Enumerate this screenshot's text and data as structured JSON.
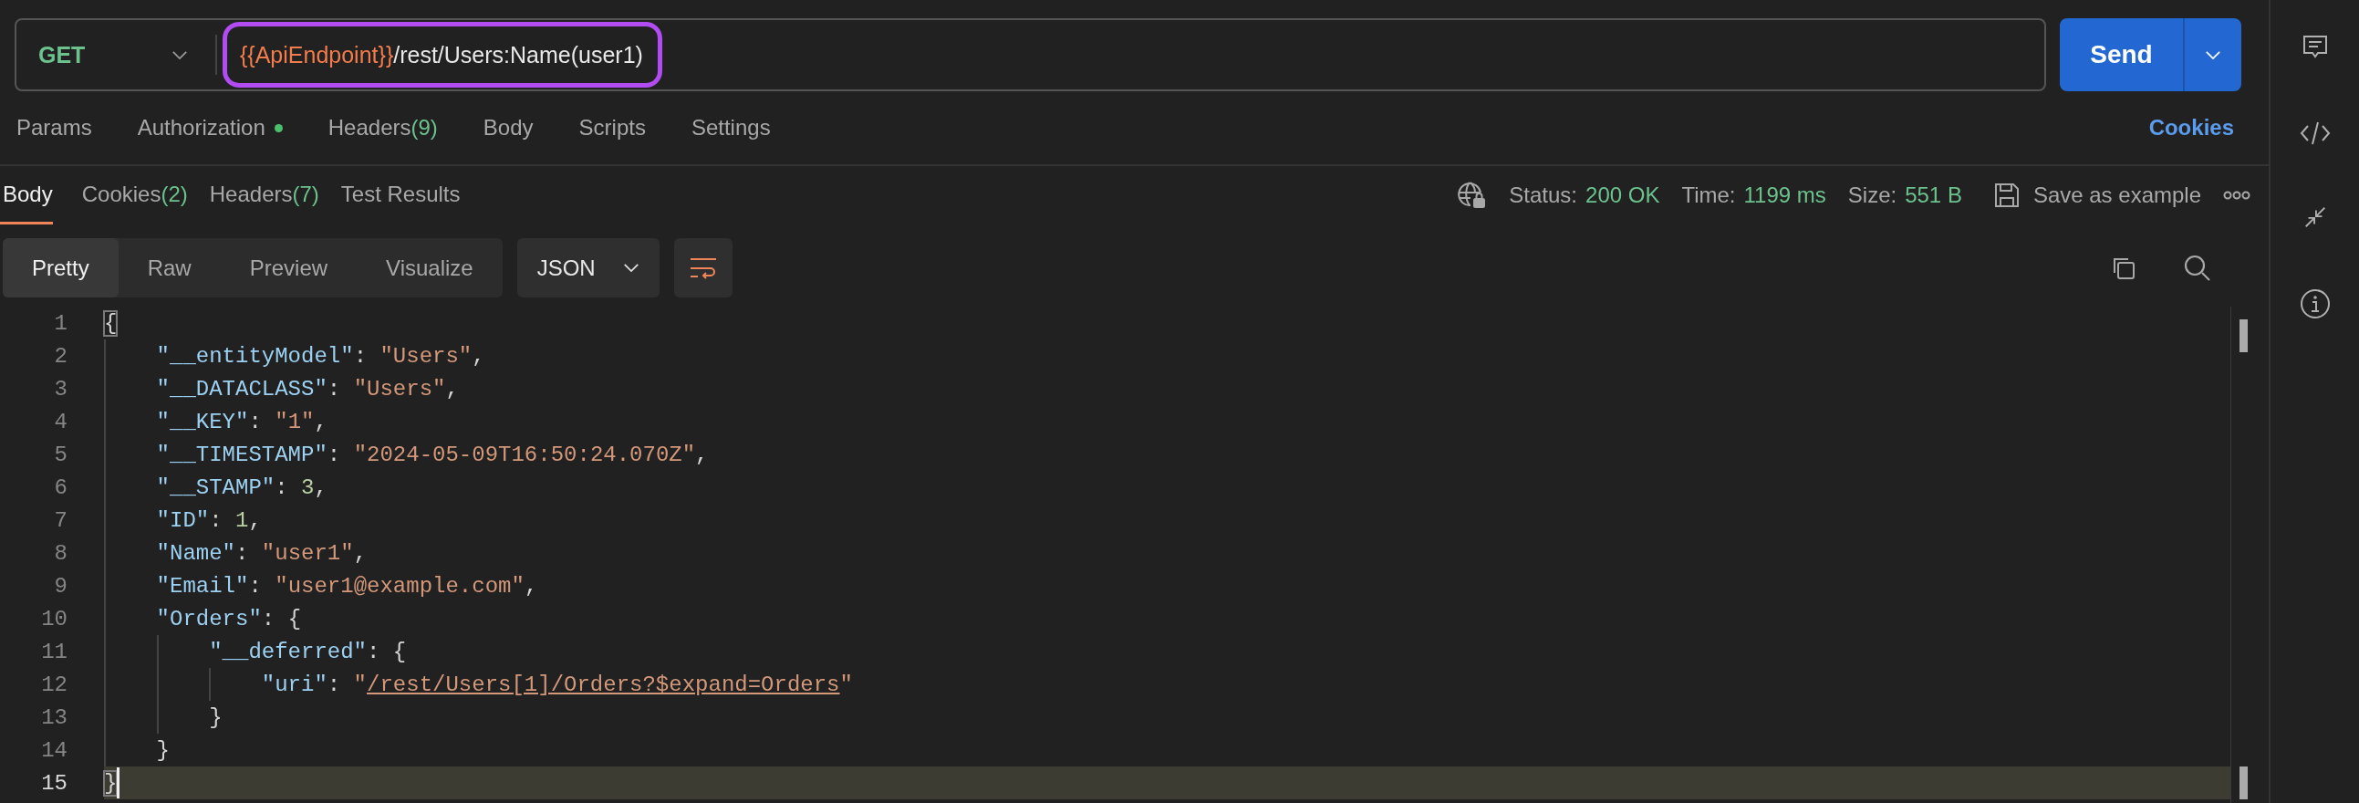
{
  "request": {
    "method": "GET",
    "url_variable": "{{ApiEndpoint}}",
    "url_path": "/rest/Users:Name(user1)",
    "send_label": "Send"
  },
  "request_tabs": [
    {
      "label": "Params",
      "selected": false,
      "dot": false
    },
    {
      "label": "Authorization",
      "selected": false,
      "dot": true
    },
    {
      "label": "Headers",
      "count": "(9)",
      "selected": false,
      "dot": false
    },
    {
      "label": "Body",
      "selected": false,
      "dot": false
    },
    {
      "label": "Scripts",
      "selected": false,
      "dot": false
    },
    {
      "label": "Settings",
      "selected": false,
      "dot": false
    }
  ],
  "cookies_link": "Cookies",
  "response_tabs": [
    {
      "label": "Body",
      "selected": true
    },
    {
      "label": "Cookies",
      "count": "(2)",
      "selected": false
    },
    {
      "label": "Headers",
      "count": "(7)",
      "selected": false
    },
    {
      "label": "Test Results",
      "selected": false
    }
  ],
  "response_meta": [
    {
      "label": "Status:",
      "value": "200 OK"
    },
    {
      "label": "Time:",
      "value": "1199 ms"
    },
    {
      "label": "Size:",
      "value": "551 B"
    }
  ],
  "save_example": "Save as example",
  "view_modes": [
    {
      "label": "Pretty",
      "selected": true
    },
    {
      "label": "Raw",
      "selected": false
    },
    {
      "label": "Preview",
      "selected": false
    },
    {
      "label": "Visualize",
      "selected": false
    }
  ],
  "format": "JSON",
  "response": {
    "lines": [
      {
        "number": "1",
        "current": false,
        "tokens": [
          {
            "kind": "bracket",
            "text": "{",
            "matched": true
          }
        ],
        "children": [
          {
            "number": "2",
            "current": false,
            "tokens": [
              {
                "kind": "key",
                "text": "\"__entityModel\""
              },
              {
                "kind": "punct",
                "text": ": "
              },
              {
                "kind": "string",
                "text": "\"Users\""
              },
              {
                "kind": "punct",
                "text": ","
              }
            ]
          },
          {
            "number": "3",
            "current": false,
            "tokens": [
              {
                "kind": "key",
                "text": "\"__DATACLASS\""
              },
              {
                "kind": "punct",
                "text": ": "
              },
              {
                "kind": "string",
                "text": "\"Users\""
              },
              {
                "kind": "punct",
                "text": ","
              }
            ]
          },
          {
            "number": "4",
            "current": false,
            "tokens": [
              {
                "kind": "key",
                "text": "\"__KEY\""
              },
              {
                "kind": "punct",
                "text": ": "
              },
              {
                "kind": "string",
                "text": "\"1\""
              },
              {
                "kind": "punct",
                "text": ","
              }
            ]
          },
          {
            "number": "5",
            "current": false,
            "tokens": [
              {
                "kind": "key",
                "text": "\"__TIMESTAMP\""
              },
              {
                "kind": "punct",
                "text": ": "
              },
              {
                "kind": "string",
                "text": "\"2024-05-09T16:50:24.070Z\""
              },
              {
                "kind": "punct",
                "text": ","
              }
            ]
          },
          {
            "number": "6",
            "current": false,
            "tokens": [
              {
                "kind": "key",
                "text": "\"__STAMP\""
              },
              {
                "kind": "punct",
                "text": ": "
              },
              {
                "kind": "number",
                "text": "3"
              },
              {
                "kind": "punct",
                "text": ","
              }
            ]
          },
          {
            "number": "7",
            "current": false,
            "tokens": [
              {
                "kind": "key",
                "text": "\"ID\""
              },
              {
                "kind": "punct",
                "text": ": "
              },
              {
                "kind": "number",
                "text": "1"
              },
              {
                "kind": "punct",
                "text": ","
              }
            ]
          },
          {
            "number": "8",
            "current": false,
            "tokens": [
              {
                "kind": "key",
                "text": "\"Name\""
              },
              {
                "kind": "punct",
                "text": ": "
              },
              {
                "kind": "string",
                "text": "\"user1\""
              },
              {
                "kind": "punct",
                "text": ","
              }
            ]
          },
          {
            "number": "9",
            "current": false,
            "tokens": [
              {
                "kind": "key",
                "text": "\"Email\""
              },
              {
                "kind": "punct",
                "text": ": "
              },
              {
                "kind": "string",
                "text": "\"user1@example.com\""
              },
              {
                "kind": "punct",
                "text": ","
              }
            ]
          },
          {
            "number": "10",
            "current": false,
            "tokens": [
              {
                "kind": "key",
                "text": "\"Orders\""
              },
              {
                "kind": "punct",
                "text": ": "
              },
              {
                "kind": "bracket",
                "text": "{",
                "matched": false
              }
            ],
            "children": [
              {
                "number": "11",
                "current": false,
                "tokens": [
                  {
                    "kind": "key",
                    "text": "\"__deferred\""
                  },
                  {
                    "kind": "punct",
                    "text": ": "
                  },
                  {
                    "kind": "bracket",
                    "text": "{",
                    "matched": false
                  }
                ],
                "children": [
                  {
                    "number": "12",
                    "current": false,
                    "tokens": [
                      {
                        "kind": "key",
                        "text": "\"uri\""
                      },
                      {
                        "kind": "punct",
                        "text": ": "
                      },
                      {
                        "kind": "string",
                        "text": "\""
                      },
                      {
                        "kind": "link",
                        "text": "/rest/Users[1]/Orders?$expand=Orders"
                      },
                      {
                        "kind": "string",
                        "text": "\""
                      }
                    ]
                  }
                ]
              },
              {
                "number": "13",
                "current": false,
                "tokens": [
                  {
                    "kind": "bracket",
                    "text": "}",
                    "matched": false
                  }
                ]
              }
            ]
          },
          {
            "number": "14",
            "current": false,
            "tokens": [
              {
                "kind": "bracket",
                "text": "}",
                "matched": false
              }
            ]
          }
        ]
      },
      {
        "number": "15",
        "current": true,
        "tokens": [
          {
            "kind": "bracket",
            "text": "}",
            "matched": true
          }
        ]
      }
    ]
  }
}
